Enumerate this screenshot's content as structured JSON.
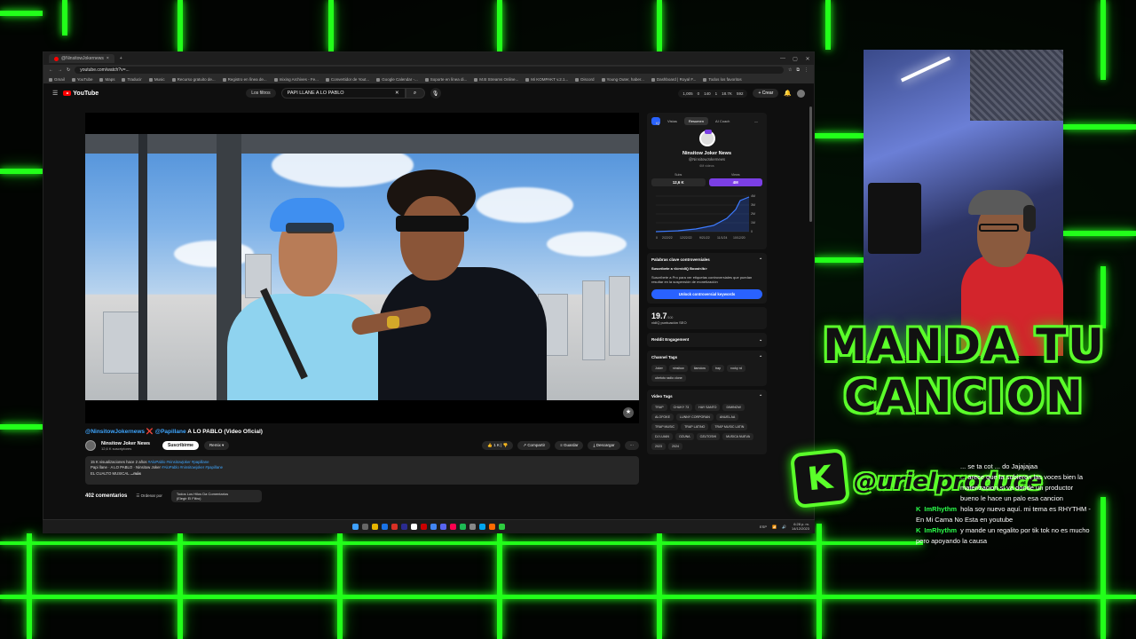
{
  "browser": {
    "tab_title": "@NinsitowJokernews",
    "url": "youtube.com/watch?v=...",
    "bookmarks": [
      "Gmail",
      "YouTube",
      "Maps",
      "Traducir",
      "Music",
      "Recurso gratuito de...",
      "Registro en línea de...",
      "mixing Archives - Fe...",
      "Convertidor de Yout...",
      "Google Calendar -...",
      "Soporte en línea di...",
      "M.B Streams Online...",
      "Mi KOMPAKT v.2.1...",
      "Discord",
      "Young Outer, haber...",
      "Dashboard | Royal F...",
      "Todos los favoritos"
    ]
  },
  "youtube": {
    "logo": "YouTube",
    "filters_label": "Los filtros",
    "search_value": "PAPI LLANE A LO PABLO",
    "header_stats": [
      "1,005",
      "0",
      "140",
      "1",
      "18.7K",
      "592"
    ],
    "create_label": "Crear"
  },
  "video": {
    "title_tag1": "@NinsitowJokernews",
    "title_x": "❌",
    "title_tag2": "@Papillane",
    "title_text": "A LO PABLO (Video Oficial)",
    "channel_name": "Ninsitow Joker News",
    "channel_subs": "12,6 K suscriptores",
    "subscribe_label": "Suscribirme",
    "remix_label": "Remix",
    "likes": "1 K",
    "share_label": "Compartir",
    "save_label": "Guardar",
    "download_label": "Descargar",
    "desc_line1": "15 K visualizaciones  hace 2 años",
    "desc_hashtags1": "#AloPablo #ninsitowjoker #papillane",
    "desc_line2a": "Papi llane · A LO PABLO · Ninsitow Joker",
    "desc_hashtags2": "#AloPablo #ninsitowjoker #papillane",
    "desc_line3": "EL CUALTO MUSICAL",
    "desc_more": "...más",
    "comments_count": "402 comentarios",
    "sort_label": "Ordenar por",
    "sort_dd_line1": "Todos Los Hilos Da Comentarios",
    "sort_dd_line2": "(Elegir El Filtro)"
  },
  "sidebar": {
    "tabs": [
      "Vistas",
      "Resumen",
      "AI Coach"
    ],
    "channel_name": "Ninsitow Joker News",
    "channel_handle": "@NinsitowJokernews",
    "small_note": "6M vídeos",
    "stat_labels": [
      "Subs",
      "Views"
    ],
    "stat_values": [
      "12,6 K",
      "4M"
    ],
    "chart_ylabels": [
      "4M",
      "3M",
      "2M",
      "1M",
      "0"
    ],
    "chart_xlabels": [
      "0",
      "2/22/22",
      "12/22/22",
      "9/21/22",
      "11/1/24",
      "10/12/20"
    ],
    "controversial_title": "Palabras clave controversiales",
    "pro_line": "Suscríbete a <b>vidIQ Boost</b>",
    "pro_text": "Suscríbete a Pro para ver etiquetas controversiales que puedan resultar en la suspensión de monetización",
    "unlock_label": "Unlock controversial keywords",
    "seo_score": "19.7",
    "seo_score_suffix": "/100",
    "seo_label": "vidIQ puntuación SEO",
    "reddit_label": "Reddit Engagement",
    "channel_tags_label": "Channel Tags",
    "channel_tags": [
      "Joker",
      "ninsitow",
      "ilamdow",
      "trap",
      "rocky rd",
      "ubetoto radio clone"
    ],
    "video_tags_label": "Video Tags",
    "video_tags": [
      "TRAP",
      "CHUKY 73",
      "HAY SANTO",
      "DIMINOW",
      "ALOFOKE",
      "LUNNY CORPORAN",
      "ANUEL AA",
      "TRAP MUSIC",
      "TRAP LATINO",
      "TRAP MUSIC LATIN",
      "DJ LUIAN",
      "OZUNA",
      "OZUTOSHI",
      "MUSICA NUEVA",
      "2023",
      "2024"
    ]
  },
  "taskbar": {
    "tray_lang": "ESP",
    "time": "6:28 p. m.",
    "date": "14/12/2023"
  },
  "overlay": {
    "line1": "MANDA TU",
    "line2": "CANCION",
    "k_logo": "K",
    "handle": "@urielproduce"
  },
  "chat": [
    {
      "user": "",
      "text": "... se ta cot ... do Jajajajaa"
    },
    {
      "user": "",
      "text": "... arece que la subieron las voces bien la materizacion si va donde un productor bueno le hace un palo esa cancion"
    },
    {
      "user": "ImRhythm",
      "text": "hola soy nuevo aquí. mi tema es RHYTHM - En Mi Cama No Esta en youtube"
    },
    {
      "user": "ImRhythm",
      "text": "y mande un regalito por tik tok no es mucho pero apoyando la causa"
    }
  ],
  "colors": {
    "neon_green": "#22ff1a",
    "youtube_red": "#ff0000",
    "vidiq_blue": "#2962ff",
    "vidiq_purple": "#7b3fe4"
  }
}
